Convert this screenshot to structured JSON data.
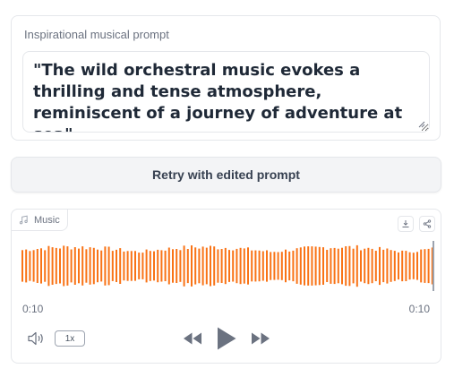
{
  "prompt_panel": {
    "label": "Inspirational musical prompt",
    "text": "\"The wild orchestral music evokes a thrilling and tense atmosphere, reminiscent of a journey of adventure at sea\""
  },
  "retry": {
    "label": "Retry with edited prompt"
  },
  "audio": {
    "label": "Music",
    "time_current": "0:10",
    "time_total": "0:10",
    "speed": "1x",
    "progress": 1.0,
    "wave_color": "#f97316",
    "icons": [
      "music-icon",
      "download-icon",
      "share-icon",
      "volume-icon",
      "rewind-icon",
      "play-icon",
      "fast-forward-icon"
    ]
  }
}
